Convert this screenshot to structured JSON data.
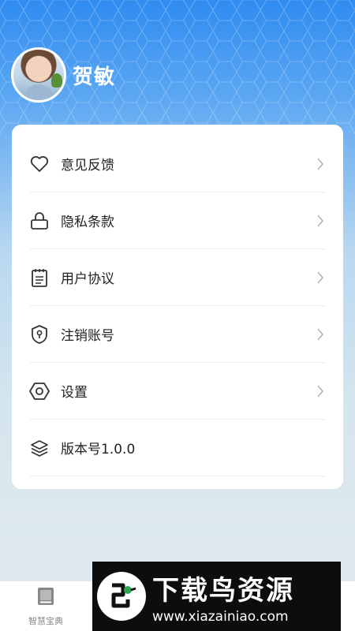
{
  "profile": {
    "name": "贺敏"
  },
  "menu": {
    "items": [
      {
        "label": "意见反馈",
        "icon": "heart-icon",
        "has_chevron": true
      },
      {
        "label": "隐私条款",
        "icon": "lock-icon",
        "has_chevron": true
      },
      {
        "label": "用户协议",
        "icon": "notepad-icon",
        "has_chevron": true
      },
      {
        "label": "注销账号",
        "icon": "shield-keyhole-icon",
        "has_chevron": true
      },
      {
        "label": "设置",
        "icon": "hex-nut-icon",
        "has_chevron": true
      },
      {
        "label": "版本号1.0.0",
        "icon": "layers-icon",
        "has_chevron": false
      }
    ]
  },
  "tabbar": {
    "tabs": [
      {
        "label": "智慧宝典",
        "icon": "book-icon"
      }
    ]
  },
  "watermark": {
    "title": "下载鸟资源",
    "url": "www.xiazainiao.com"
  },
  "colors": {
    "header_blue": "#2f8cf0",
    "background_bottom": "#e2ebee",
    "text": "#222222",
    "icon": "#333333",
    "chevron": "#b5b5b5"
  }
}
